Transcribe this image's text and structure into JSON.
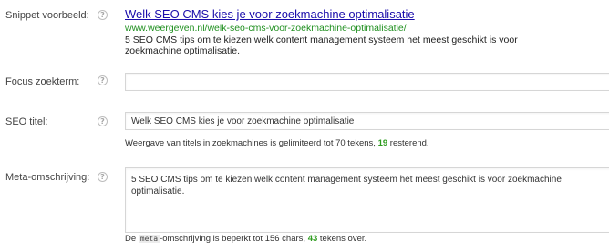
{
  "labels": {
    "snippet": "Snippet voorbeeld:",
    "focus": "Focus zoekterm:",
    "seo_title": "SEO titel:",
    "meta_description": "Meta-omschrijving:"
  },
  "help_icon_glyph": "?",
  "snippet": {
    "title": "Welk SEO CMS kies je voor zoekmachine optimalisatie",
    "url": "www.weergeven.nl/welk-seo-cms-voor-zoekmachine-optimalisatie/",
    "description": "5 SEO CMS tips om te kiezen welk content management systeem het meest geschikt is voor zoekmachine optimalisatie."
  },
  "focus_keyword": {
    "value": "",
    "placeholder": ""
  },
  "seo_title": {
    "value": "Welk SEO CMS kies je voor zoekmachine optimalisatie",
    "hint_prefix": "Weergave van titels in zoekmachines is gelimiteerd tot 70 tekens, ",
    "remaining": "19",
    "hint_suffix": " resterend."
  },
  "meta_description": {
    "value": "5 SEO CMS tips om te kiezen welk content management systeem het meest geschikt is voor zoekmachine optimalisatie.",
    "hint_prefix": "De ",
    "hint_code": "meta",
    "hint_middle": "-omschrijving is beperkt tot 156 chars, ",
    "remaining": "43",
    "hint_suffix": " tekens over."
  },
  "colors": {
    "link": "#1a0dab",
    "url_green": "#1f8f1f",
    "count_green": "#2e9c1f"
  }
}
